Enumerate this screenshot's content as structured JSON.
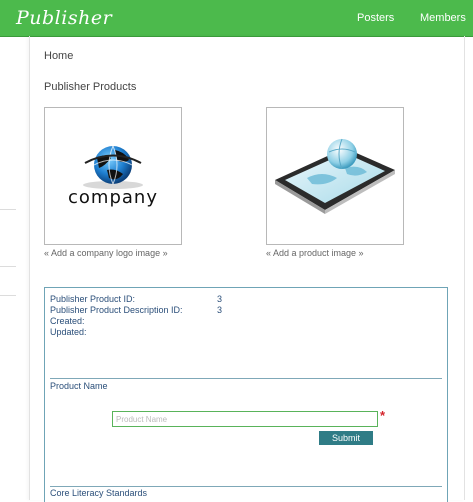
{
  "app": {
    "brand": "Publisher",
    "nav": [
      {
        "label": "Posters"
      },
      {
        "label": "Members"
      }
    ]
  },
  "breadcrumb": "Home",
  "section_title": "Publisher Products",
  "images": {
    "logo_caption": "« Add a company logo image »",
    "logo_text": "company",
    "product_caption": "« Add a product image »"
  },
  "details": {
    "rows": [
      {
        "label": "Publisher Product ID:",
        "value": "3"
      },
      {
        "label": "Publisher Product Description ID:",
        "value": "3"
      },
      {
        "label": "Created:",
        "value": ""
      },
      {
        "label": "Updated:",
        "value": ""
      }
    ],
    "product_name_label": "Product Name",
    "product_name_placeholder": "Product Name",
    "product_name_value": "",
    "required_marker": "*",
    "submit_label": "Submit",
    "next_section_label": "Core Literacy Standards"
  },
  "colors": {
    "brand_green": "#4cba4c",
    "accent_teal": "#2f7c86",
    "required_red": "#d4242c"
  }
}
